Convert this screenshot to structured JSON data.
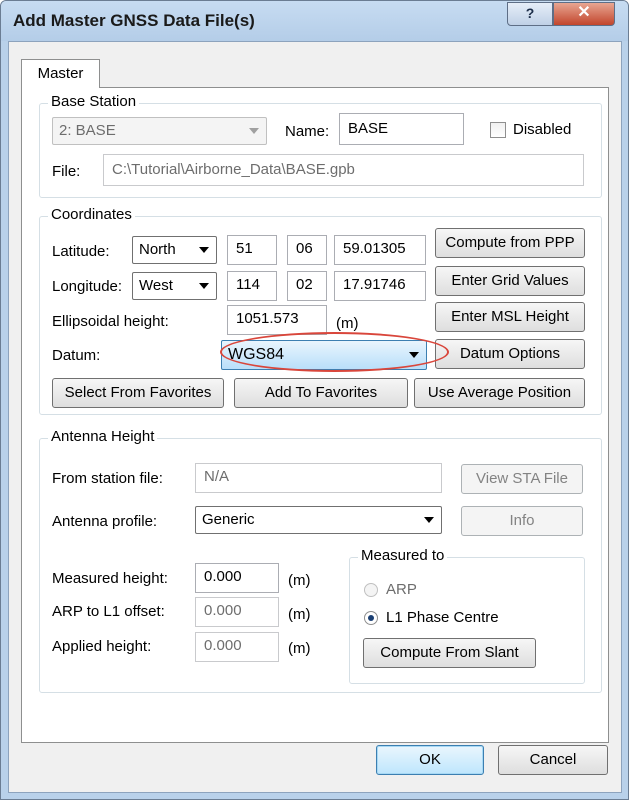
{
  "window": {
    "title": "Add Master GNSS Data File(s)",
    "help_label": "?",
    "close_label": "✕"
  },
  "tab": {
    "label": "Master"
  },
  "base_station": {
    "group_label": "Base Station",
    "station_select": "2: BASE",
    "name_label": "Name:",
    "name_value": "BASE",
    "disabled_label": "Disabled",
    "disabled_checked": false,
    "file_label": "File:",
    "file_value": "C:\\Tutorial\\Airborne_Data\\BASE.gpb"
  },
  "coordinates": {
    "group_label": "Coordinates",
    "latitude_label": "Latitude:",
    "latitude_dir": "North",
    "latitude_deg": "51",
    "latitude_min": "06",
    "latitude_sec": "59.01305",
    "longitude_label": "Longitude:",
    "longitude_dir": "West",
    "longitude_deg": "114",
    "longitude_min": "02",
    "longitude_sec": "17.91746",
    "ellipsoidal_label": "Ellipsoidal height:",
    "ellipsoidal_value": "1051.573",
    "ellipsoidal_unit": "(m)",
    "datum_label": "Datum:",
    "datum_value": "WGS84",
    "compute_ppp": "Compute from PPP",
    "enter_grid": "Enter Grid Values",
    "enter_msl": "Enter MSL Height",
    "datum_options": "Datum Options",
    "select_favorites": "Select From Favorites",
    "add_favorites": "Add To Favorites",
    "use_average": "Use Average Position"
  },
  "antenna": {
    "group_label": "Antenna Height",
    "station_file_label": "From station file:",
    "station_file_value": "N/A",
    "view_sta": "View STA File",
    "profile_label": "Antenna profile:",
    "profile_value": "Generic",
    "info": "Info",
    "measured_label": "Measured height:",
    "measured_value": "0.000",
    "measured_unit": "(m)",
    "arp_offset_label": "ARP to L1 offset:",
    "arp_offset_value": "0.000",
    "arp_offset_unit": "(m)",
    "applied_label": "Applied height:",
    "applied_value": "0.000",
    "applied_unit": "(m)",
    "measured_to_label": "Measured to",
    "arp_label": "ARP",
    "l1_label": "L1 Phase Centre",
    "selected": "L1 Phase Centre",
    "compute_slant": "Compute From Slant"
  },
  "footer": {
    "ok": "OK",
    "cancel": "Cancel"
  },
  "colors": {
    "highlight_ellipse": "#d9463b",
    "title_bar": "#b9d1ea"
  }
}
